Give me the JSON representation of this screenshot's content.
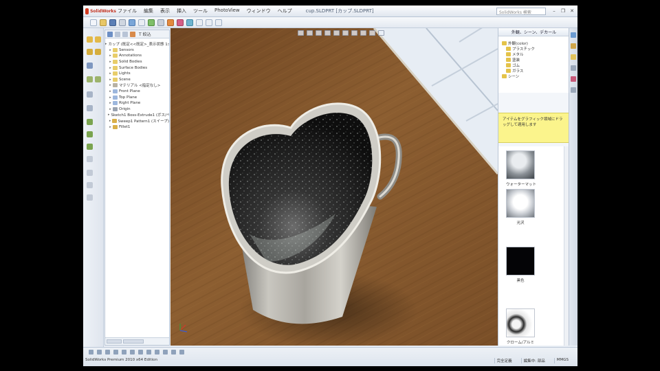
{
  "app": {
    "logo_text": "SolidWorks",
    "menu": [
      "ファイル",
      "編集",
      "表示",
      "挿入",
      "ツール",
      "PhotoView",
      "ウィンドウ",
      "ヘルプ"
    ],
    "document_title": "cup.SLDPRT [カップ.SLDPRT]",
    "search_placeholder": "SolidWorks 検索"
  },
  "feature_tree": {
    "filter_label": "T 絞込",
    "items": [
      {
        "label": "カップ (既定<<既定>_表示状態 1>)",
        "indent": 0,
        "icon": "part-icon"
      },
      {
        "label": "Sensors",
        "indent": 1,
        "icon": "folder-icon"
      },
      {
        "label": "Annotations",
        "indent": 1,
        "icon": "folder-icon"
      },
      {
        "label": "Solid Bodies",
        "indent": 1,
        "icon": "folder-icon"
      },
      {
        "label": "Surface Bodies",
        "indent": 1,
        "icon": "folder-icon"
      },
      {
        "label": "Lights",
        "indent": 1,
        "icon": "folder-icon"
      },
      {
        "label": "Scene",
        "indent": 1,
        "icon": "folder-icon"
      },
      {
        "label": "マテリアル <指定なし>",
        "indent": 1,
        "icon": "material-icon"
      },
      {
        "label": "Front Plane",
        "indent": 1,
        "icon": "plane-icon"
      },
      {
        "label": "Top Plane",
        "indent": 1,
        "icon": "plane-icon"
      },
      {
        "label": "Right Plane",
        "indent": 1,
        "icon": "plane-icon"
      },
      {
        "label": "Origin",
        "indent": 1,
        "icon": "origin-icon"
      },
      {
        "label": "Sketch1 Boss-Extrude1 (ボス/ベース)",
        "indent": 1,
        "icon": "feature-icon"
      },
      {
        "label": "Sweep1 Pattern1 (スイープ)",
        "indent": 1,
        "icon": "feature-icon"
      },
      {
        "label": "Fillet1",
        "indent": 1,
        "icon": "feature-icon"
      }
    ]
  },
  "task_pane": {
    "header": "外観、シーン、デカール",
    "tree": [
      {
        "label": "外観(color)",
        "level": 1
      },
      {
        "label": "プラスチック",
        "level": 2
      },
      {
        "label": "メタル",
        "level": 2
      },
      {
        "label": "塗装",
        "level": 2
      },
      {
        "label": "ゴム",
        "level": 2
      },
      {
        "label": "ガラス",
        "level": 2
      },
      {
        "label": "シーン",
        "level": 1
      }
    ],
    "info_text": "アイテムをグラフィック領域にドラッグして適用します",
    "swatches": [
      {
        "name": "water-swatch",
        "label": "ウォーターマット"
      },
      {
        "name": "plastic-swatch",
        "label": "光沢"
      },
      {
        "name": "black-swatch",
        "label": "黒色"
      },
      {
        "name": "metal-swatch",
        "label": "クローム/アルミ"
      }
    ]
  },
  "statusbar": {
    "text": "SolidWorks Premium 2010 x64 Edition",
    "fields": [
      "完全定義",
      "編集中: 部品",
      "MMGS"
    ]
  },
  "colors": {
    "table_wood": "#8a5a2c",
    "tile": "#dfe6ef",
    "metal": "#a6a49e",
    "liquid": "#1a1a1a",
    "info_banner": "#fbf48c"
  }
}
